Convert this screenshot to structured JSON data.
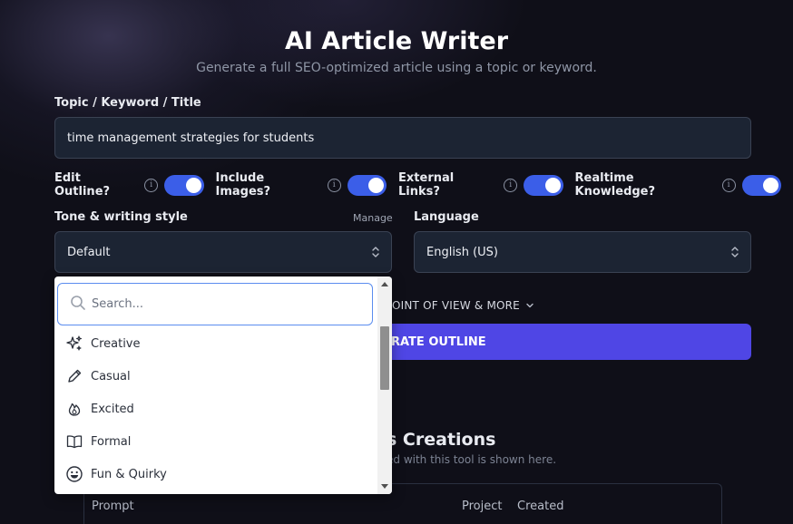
{
  "header": {
    "title": "AI Article Writer",
    "subtitle": "Generate a full SEO-optimized article using a topic or keyword."
  },
  "topic": {
    "label": "Topic / Keyword / Title",
    "value": "time management strategies for students"
  },
  "toggles": [
    {
      "label": "Edit Outline?",
      "on": true
    },
    {
      "label": "Include Images?",
      "on": true
    },
    {
      "label": "External Links?",
      "on": true
    },
    {
      "label": "Realtime Knowledge?",
      "on": true
    }
  ],
  "tone": {
    "label": "Tone & writing style",
    "manage_label": "Manage",
    "selected": "Default"
  },
  "language": {
    "label": "Language",
    "selected": "English (US)"
  },
  "more_options_label": "OINT OF VIEW & MORE",
  "generate_button_label": "RATE OUTLINE",
  "creations": {
    "title": "s Creations",
    "subtitle": "ed with this tool is shown here.",
    "columns": [
      "Prompt",
      "Project",
      "Created"
    ]
  },
  "dropdown": {
    "search_placeholder": "Search...",
    "options": [
      {
        "label": "Creative",
        "icon": "sparkles-icon"
      },
      {
        "label": "Casual",
        "icon": "pencil-icon"
      },
      {
        "label": "Excited",
        "icon": "flame-icon"
      },
      {
        "label": "Formal",
        "icon": "book-open-icon"
      },
      {
        "label": "Fun & Quirky",
        "icon": "smiley-icon"
      }
    ]
  },
  "colors": {
    "accent": "#4f46e5",
    "toggle_on": "#3b5ee8",
    "field_bg": "#1c2433",
    "background": "#0f0f18"
  }
}
